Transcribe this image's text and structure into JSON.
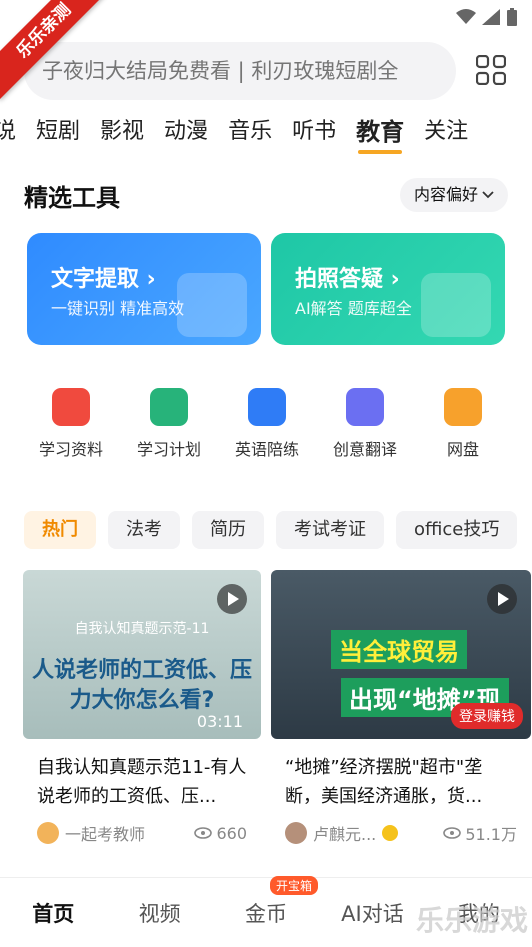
{
  "status_bar": {
    "ribbon": "乐乐亲测"
  },
  "search": {
    "placeholder": "子夜归大结局免费看 | 利刃玫瑰短剧全"
  },
  "categories": [
    "说",
    "短剧",
    "影视",
    "动漫",
    "音乐",
    "听书",
    "教育",
    "关注"
  ],
  "active_category": "教育",
  "section": {
    "title": "精选工具",
    "pref_label": "内容偏好"
  },
  "tool_cards": [
    {
      "title": "文字提取 ›",
      "subtitle": "一键识别 精准高效",
      "color": "#2f8bff"
    },
    {
      "title": "拍照答疑 ›",
      "subtitle": "AI解答 题库超全",
      "color": "#1ec7a6"
    }
  ],
  "shortcuts": [
    {
      "label": "学习资料",
      "icon": "study-material-icon",
      "color": "#f04a3e"
    },
    {
      "label": "学习计划",
      "icon": "study-plan-icon",
      "color": "#27b37a"
    },
    {
      "label": "英语陪练",
      "icon": "english-practice-icon",
      "color": "#2f7cf6"
    },
    {
      "label": "创意翻译",
      "icon": "translate-icon",
      "color": "#6b6ff2"
    },
    {
      "label": "网盘",
      "icon": "cloud-drive-icon",
      "color": "#f7a12c"
    }
  ],
  "chips": [
    "热门",
    "法考",
    "简历",
    "考试考证",
    "office技巧"
  ],
  "videos": [
    {
      "thumb_top": "自我认知真题示范-11",
      "thumb_big": "人说老师的工资低、压力大你怎么看?",
      "duration": "03:11",
      "title": "自我认知真题示范11-有人说老师的工资低、压...",
      "author": "一起考教师",
      "views": "660"
    },
    {
      "thumb_a": "当全球贸易",
      "thumb_b": "出现“地摊”现",
      "login": "登录赚钱",
      "title": "“地摊”经济摆脱\"超市\"垄断，美国经济通胀，货...",
      "author": "卢麒元...",
      "views": "51.1万"
    }
  ],
  "bottom_nav": [
    "首页",
    "视频",
    "金币",
    "AI对话",
    "我的"
  ],
  "coin_badge": "开宝箱",
  "watermark": "乐乐游戏"
}
